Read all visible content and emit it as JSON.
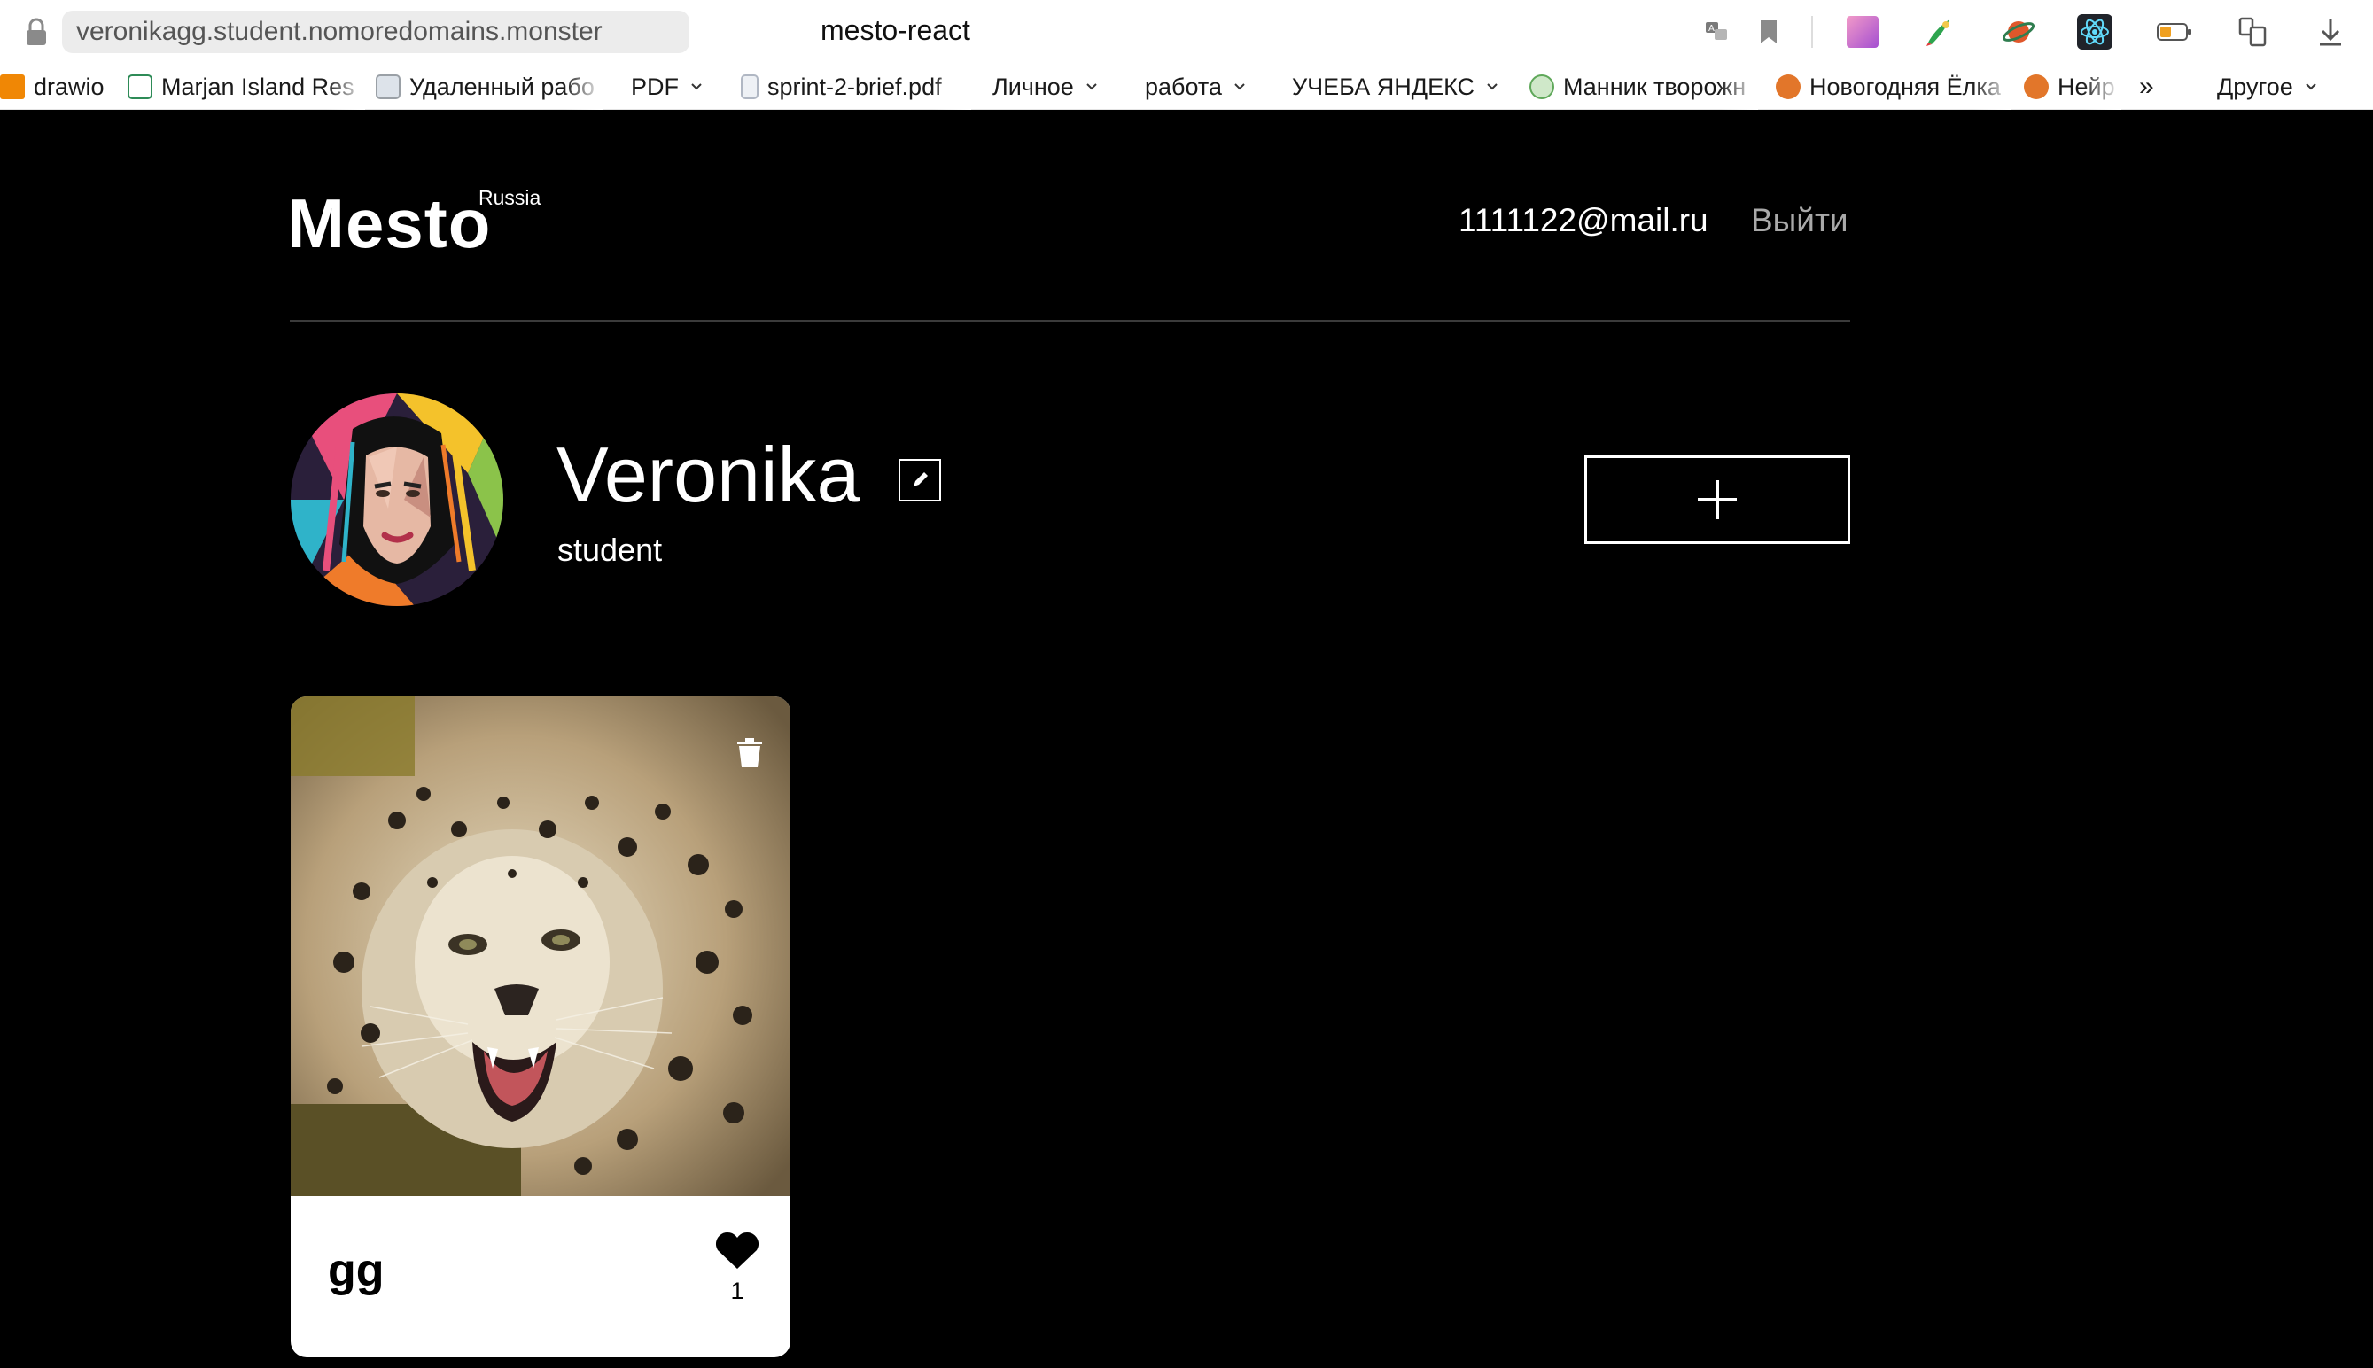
{
  "browser": {
    "url": "veronikagg.student.nomoredomains.monster",
    "tab_title": "mesto-react",
    "icons": [
      "lock-icon",
      "translate-icon",
      "bookmark-icon",
      "extension-gradient-icon",
      "extension-brush-icon",
      "extension-planet-icon",
      "react-devtools-icon",
      "battery-icon",
      "reader-icon",
      "download-icon"
    ],
    "bookmarks": [
      {
        "label": "drawio",
        "icon": "drawio-icon",
        "color": "#f08705"
      },
      {
        "label": "Marjan Island Res",
        "icon": "hotel-icon",
        "color": "#2e8b57"
      },
      {
        "label": "Удаленный рабо",
        "icon": "remote-work-icon",
        "color": "#9aa0a6"
      },
      {
        "label": "PDF",
        "folder": true
      },
      {
        "label": "sprint-2-brief.pdf",
        "icon": "pdf-file-icon",
        "color": "#b0b7c3"
      },
      {
        "label": "Личное",
        "folder": true
      },
      {
        "label": "работа",
        "folder": true
      },
      {
        "label": "УЧЕБА ЯНДЕКС",
        "folder": true
      },
      {
        "label": "Манник творожн",
        "icon": "recipe-icon",
        "color": "#5fa85a"
      },
      {
        "label": "Новогодняя Ёлка",
        "icon": "tree-icon",
        "color": "#e2762a"
      },
      {
        "label": "Нейр",
        "icon": "neural-icon",
        "color": "#e2762a"
      },
      {
        "label": "»",
        "more": true
      },
      {
        "label": "Другое",
        "folder": true
      }
    ]
  },
  "header": {
    "logo": "Mesto",
    "logo_sub": "Russia",
    "email": "1111122@mail.ru",
    "logout": "Выйти"
  },
  "profile": {
    "name": "Veronika",
    "about": "student",
    "edit_icon": "pencil-icon",
    "add_icon": "plus-icon"
  },
  "cards": [
    {
      "title": "gg",
      "likes": "1",
      "photo": "snow-leopard-photo"
    }
  ],
  "colors": {
    "page_bg": "#000000",
    "text": "#ffffff",
    "muted": "#a9a9a9",
    "card_bg": "#ffffff"
  }
}
